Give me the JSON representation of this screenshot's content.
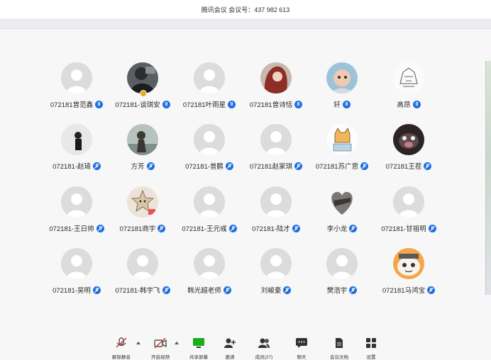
{
  "window": {
    "title": "腾讯会议  会议号：437 982 613"
  },
  "participants": [
    {
      "name": "072181曾范鑫",
      "avatar": "default",
      "mic": "on"
    },
    {
      "name": "072181-谈琪安",
      "avatar": "photo-dark-person",
      "mic": "on",
      "host": true
    },
    {
      "name": "072181叶雨星",
      "avatar": "default",
      "mic": "on"
    },
    {
      "name": "072181曾诗恬",
      "avatar": "photo-red-hair-girl",
      "mic": "on"
    },
    {
      "name": "轩",
      "avatar": "photo-baby",
      "mic": "on"
    },
    {
      "name": "高昂",
      "avatar": "sketch-line-art",
      "mic": "on"
    },
    {
      "name": "072181-赵琦",
      "avatar": "photo-person-standing",
      "mic": "muted"
    },
    {
      "name": "方芳",
      "avatar": "photo-landscape-girl",
      "mic": "muted"
    },
    {
      "name": "072181-曾鹏",
      "avatar": "default",
      "mic": "muted"
    },
    {
      "name": "072181赵家琪",
      "avatar": "default",
      "mic": "muted"
    },
    {
      "name": "072181苏广思",
      "avatar": "cartoon-dog",
      "mic": "muted"
    },
    {
      "name": "072181王茬",
      "avatar": "cartoon-pig-dark",
      "mic": "muted"
    },
    {
      "name": "072181-王日帅",
      "avatar": "default",
      "mic": "muted"
    },
    {
      "name": "072181商宇",
      "avatar": "cartoon-star",
      "mic": "muted"
    },
    {
      "name": "072181-王元彧",
      "avatar": "default",
      "mic": "muted"
    },
    {
      "name": "072181-陆才",
      "avatar": "default",
      "mic": "muted"
    },
    {
      "name": "李小龙",
      "avatar": "photo-heart",
      "mic": "muted"
    },
    {
      "name": "072181-甘祖明",
      "avatar": "default",
      "mic": "muted"
    },
    {
      "name": "072181-吴明",
      "avatar": "default",
      "mic": "muted"
    },
    {
      "name": "072181-韩宇飞",
      "avatar": "default",
      "mic": "muted"
    },
    {
      "name": "韩光超老师",
      "avatar": "default",
      "mic": "muted"
    },
    {
      "name": "刘峻豪",
      "avatar": "default",
      "mic": "muted"
    },
    {
      "name": "樊浩宇",
      "avatar": "default",
      "mic": "muted"
    },
    {
      "name": "072181马鸿宝",
      "avatar": "cartoon-face-orange",
      "mic": "muted"
    }
  ],
  "toolbar": {
    "unmute": "解除静音",
    "start_video": "开启视频",
    "share_screen": "共享屏幕",
    "invite": "邀请",
    "members": "成员(27)",
    "chat": "聊天",
    "meeting_docs": "会议文档",
    "settings": "设置"
  },
  "colors": {
    "mic_blue": "#1f6fe0",
    "host_badge": "#f3a524",
    "share_green": "#1aad19"
  }
}
